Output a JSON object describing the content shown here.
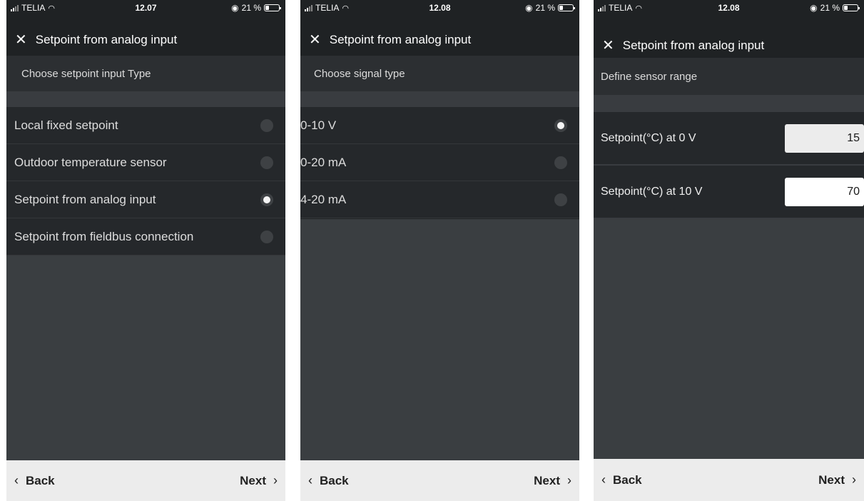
{
  "screens": [
    {
      "status": {
        "carrier": "TELIA",
        "time": "12.07",
        "battery": "21 %"
      },
      "title": "Setpoint from analog input",
      "section_header": "Choose setpoint input Type",
      "options": [
        {
          "label": "Local fixed setpoint",
          "selected": false
        },
        {
          "label": "Outdoor temperature sensor",
          "selected": false
        },
        {
          "label": "Setpoint from analog input",
          "selected": true
        },
        {
          "label": "Setpoint from fieldbus connection",
          "selected": false
        }
      ],
      "back_label": "Back",
      "next_label": "Next"
    },
    {
      "status": {
        "carrier": "TELIA",
        "time": "12.08",
        "battery": "21 %"
      },
      "title": "Setpoint from analog input",
      "section_header": "Choose signal type",
      "options": [
        {
          "label": "0-10 V",
          "selected": true
        },
        {
          "label": "0-20 mA",
          "selected": false
        },
        {
          "label": "4-20 mA",
          "selected": false
        }
      ],
      "back_label": "Back",
      "next_label": "Next"
    },
    {
      "status": {
        "carrier": "TELIA",
        "time": "12.08",
        "battery": "21 %"
      },
      "title": "Setpoint from analog input",
      "section_header": "Define sensor range",
      "fields": [
        {
          "label": "Setpoint(°C) at 0 V",
          "value": "15"
        },
        {
          "label": "Setpoint(°C) at 10 V",
          "value": "70"
        }
      ],
      "back_label": "Back",
      "next_label": "Next"
    }
  ],
  "icons": {
    "close": "✕",
    "wifi": "wifi-icon",
    "signal": "signal-icon",
    "battery": "battery-icon",
    "location": "location-icon",
    "chevron_left": "‹",
    "chevron_right": "›"
  },
  "colors": {
    "background": "#1f2224",
    "header": "#2c2f32",
    "row": "#25282b",
    "fill": "#3a3e41",
    "bottom_bar": "#ececec"
  }
}
